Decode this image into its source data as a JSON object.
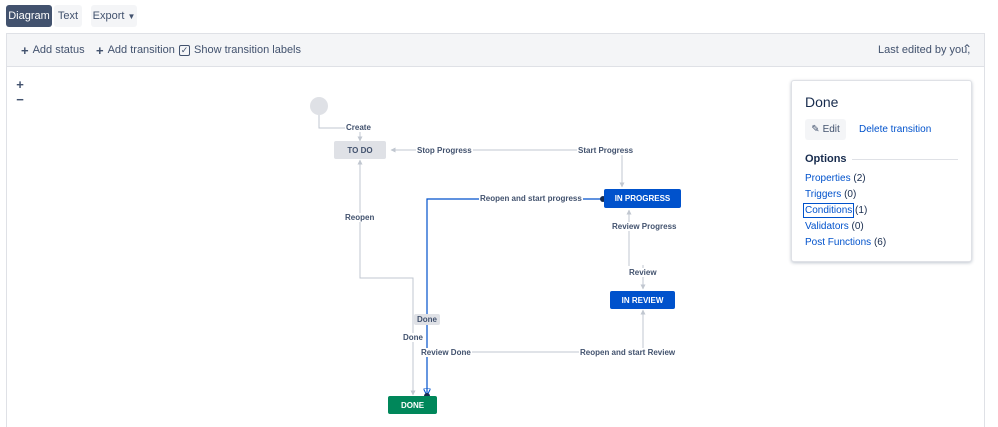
{
  "tabs": {
    "diagram": "Diagram",
    "text": "Text",
    "export": "Export"
  },
  "toolbar": {
    "add_status": "Add status",
    "add_transition": "Add transition",
    "show_labels": "Show transition labels",
    "show_labels_checked": true,
    "last_edited": "Last edited by you,"
  },
  "zoom": {
    "in": "+",
    "out": "−"
  },
  "statuses": {
    "todo": "TO DO",
    "in_progress": "IN PROGRESS",
    "in_review": "IN REVIEW",
    "done": "DONE"
  },
  "transitions": {
    "create": "Create",
    "stop_progress": "Stop Progress",
    "start_progress": "Start Progress",
    "reopen": "Reopen",
    "reopen_start_progress": "Reopen and start progress",
    "review_progress": "Review Progress",
    "review": "Review",
    "done_selected": "Done",
    "done": "Done",
    "review_done": "Review Done",
    "reopen_start_review": "Reopen and start Review"
  },
  "colors": {
    "todo": "#dfe1e6",
    "in_progress": "#0052cc",
    "done": "#00875a",
    "selected": "#0052cc",
    "line": "#c1c7d0"
  },
  "panel": {
    "title": "Done",
    "edit": "Edit",
    "delete": "Delete transition",
    "options_heading": "Options",
    "options": [
      {
        "name": "Properties",
        "count": "(2)"
      },
      {
        "name": "Triggers",
        "count": "(0)"
      },
      {
        "name": "Conditions",
        "count": "(1)"
      },
      {
        "name": "Validators",
        "count": "(0)"
      },
      {
        "name": "Post Functions",
        "count": "(6)"
      }
    ]
  }
}
